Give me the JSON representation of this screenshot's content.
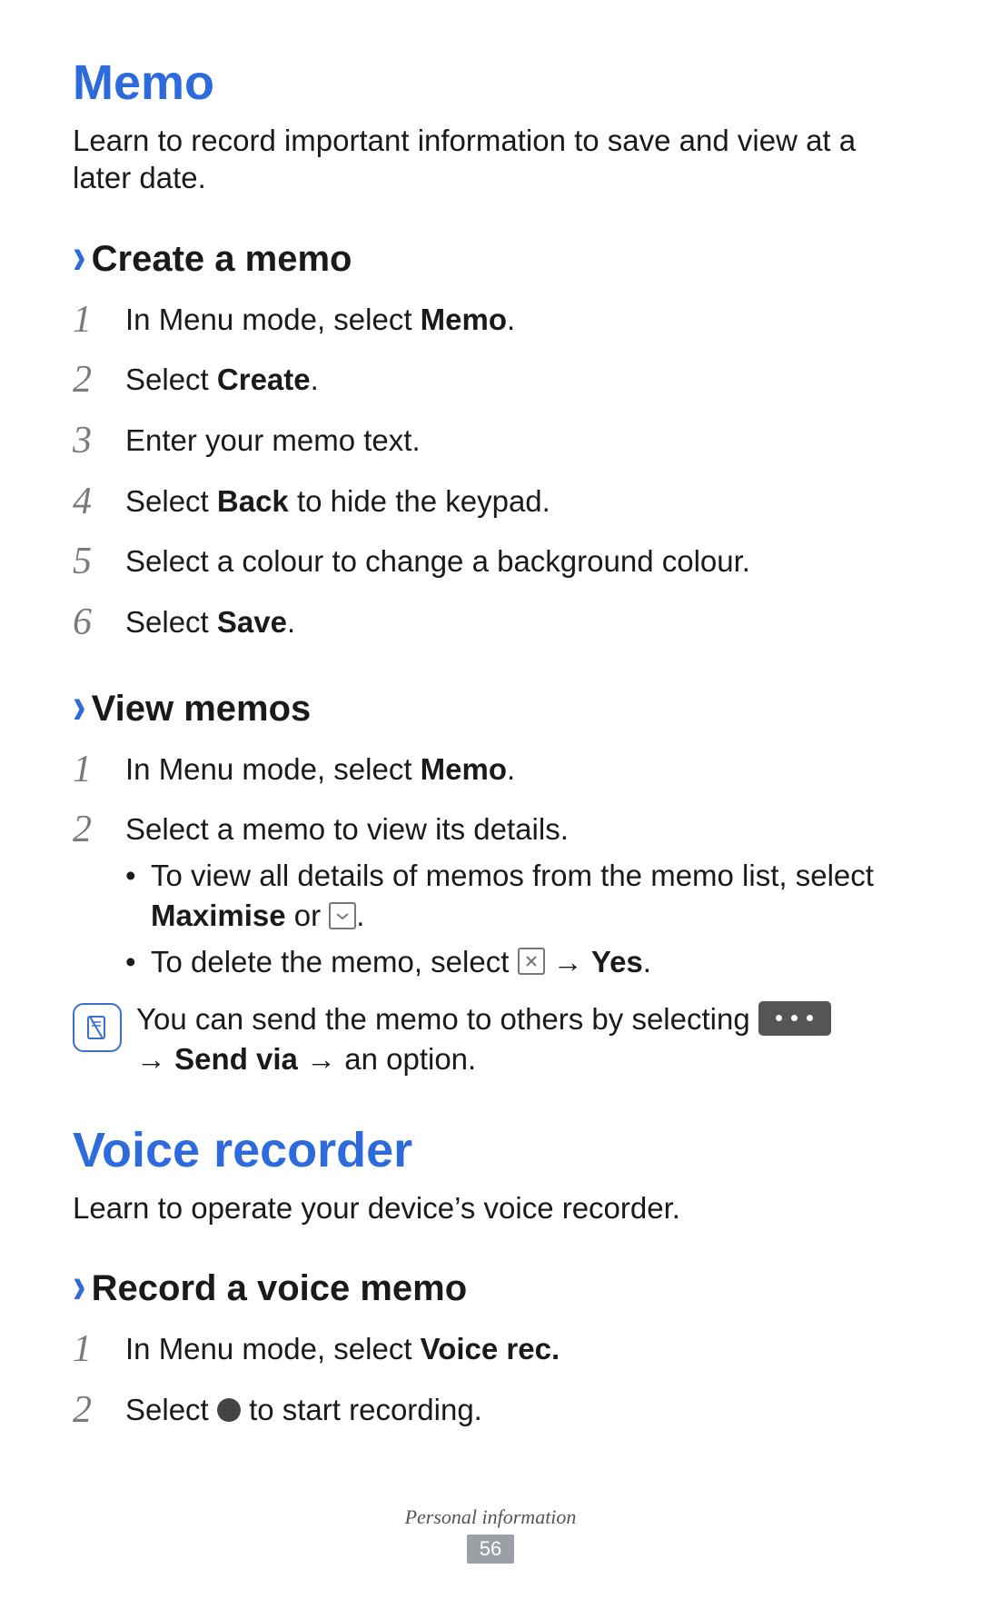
{
  "sections": {
    "memo": {
      "title": "Memo",
      "intro": "Learn to record important information to save and view at a later date.",
      "create": {
        "heading": "Create a memo",
        "steps": {
          "s1_pre": "In Menu mode, select ",
          "s1_bold": "Memo",
          "s1_post": ".",
          "s2_pre": "Select ",
          "s2_bold": "Create",
          "s2_post": ".",
          "s3": "Enter your memo text.",
          "s4_pre": "Select ",
          "s4_bold": "Back",
          "s4_post": " to hide the keypad.",
          "s5": "Select a colour to change a background colour.",
          "s6_pre": "Select ",
          "s6_bold": "Save",
          "s6_post": "."
        }
      },
      "view": {
        "heading": "View memos",
        "steps": {
          "s1_pre": "In Menu mode, select ",
          "s1_bold": "Memo",
          "s1_post": ".",
          "s2": "Select a memo to view its details."
        },
        "bullets": {
          "b1_pre": "To view all details of memos from the memo list, select ",
          "b1_bold": "Maximise",
          "b1_mid": " or ",
          "b1_post": ".",
          "b2_pre": "To delete the memo, select ",
          "b2_arrow": " → ",
          "b2_bold": "Yes",
          "b2_post": "."
        },
        "note": {
          "line1": "You can send the memo to others by selecting ",
          "arrow1": " → ",
          "bold": "Send via",
          "arrow2": " → ",
          "post": "an option."
        }
      }
    },
    "voice": {
      "title": "Voice recorder",
      "intro": "Learn to operate your device’s voice recorder.",
      "record": {
        "heading": "Record a voice memo",
        "steps": {
          "s1_pre": "In Menu mode, select ",
          "s1_bold": "Voice rec.",
          "s2_pre": "Select ",
          "s2_post": " to start recording."
        }
      }
    }
  },
  "nums": {
    "n1": "1",
    "n2": "2",
    "n3": "3",
    "n4": "4",
    "n5": "5",
    "n6": "6"
  },
  "footer": {
    "chapter": "Personal information",
    "page": "56"
  },
  "chevron": "›",
  "bullet": "•"
}
